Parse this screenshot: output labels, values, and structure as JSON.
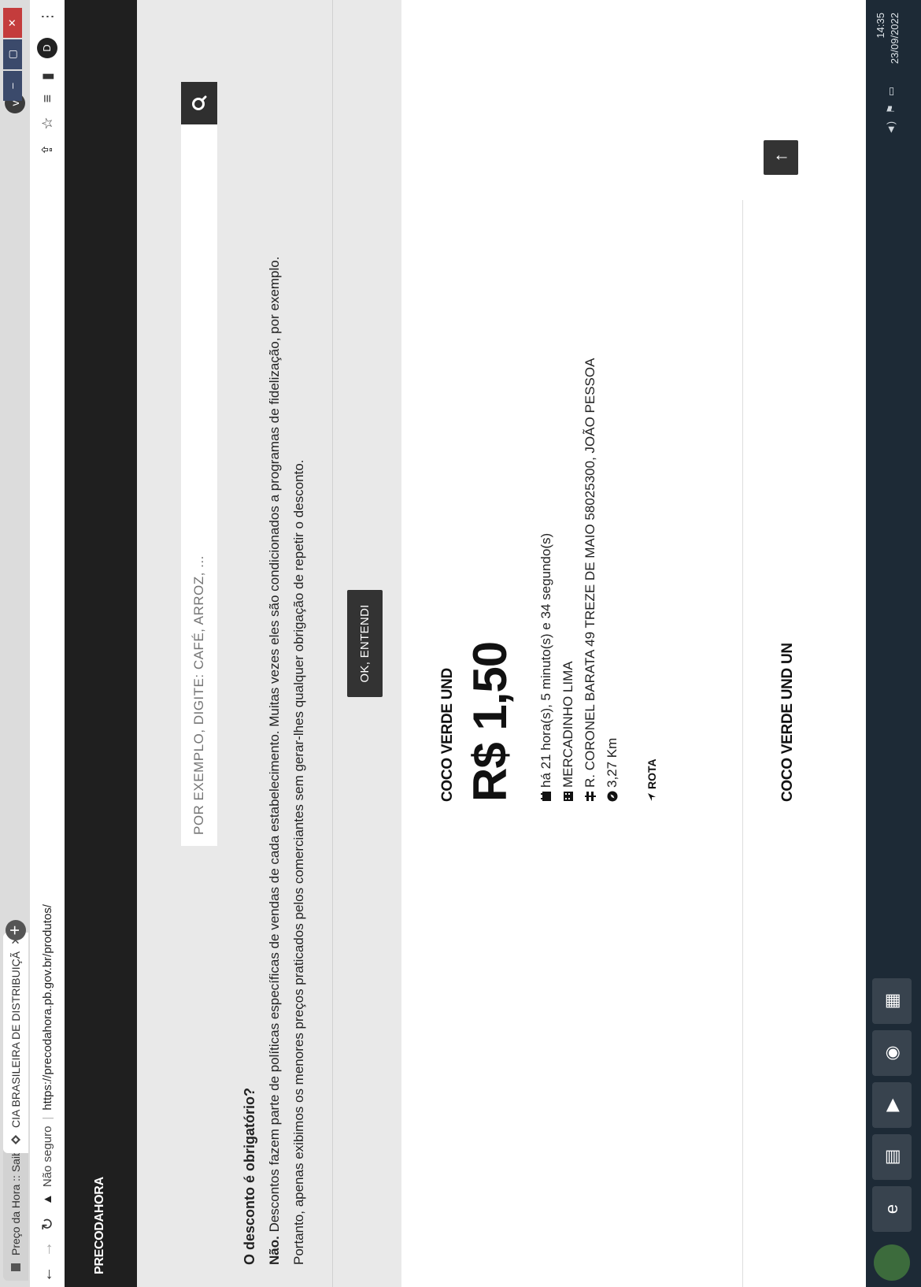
{
  "browser": {
    "tabs": [
      {
        "label": "Preço da Hora :: Saiba onde co",
        "active": false
      },
      {
        "label": "CIA BRASILEIRA DE DISTRIBUIÇÃ",
        "active": true
      }
    ],
    "close_glyph": "✕",
    "new_tab_glyph": "+",
    "security_label": "Não seguro",
    "url": "https://precodahora.pb.gov.br/produtos/",
    "avatar_initial": "D",
    "profile_chip_glyph": "v"
  },
  "header": {
    "brand": "PRECODAHORA"
  },
  "search": {
    "placeholder": "POR EXEMPLO, DIGITE: CAFÉ, ARROZ, ..."
  },
  "notice": {
    "question": "O desconto é obrigatório?",
    "answer_bold": "Não.",
    "answer_text": " Descontos fazem parte de políticas específicas de vendas de cada estabelecimento. Muitas vezes eles são condicionados a programas de fidelização, por exemplo.",
    "note": "Portanto, apenas exibimos os menores preços praticados pelos comerciantes sem gerar-lhes qualquer obrigação de repetir o desconto.",
    "ok_label": "OK, ENTENDI"
  },
  "results": [
    {
      "product": "COCO VERDE UND",
      "price": "R$ 1,50",
      "time_ago": "há 21 hora(s), 5 minuto(s) e 34 segundo(s)",
      "store": "MERCADINHO LIMA",
      "address": "R. CORONEL BARATA 49 TREZE DE MAIO 58025300, JOÃO PESSOA",
      "distance": "3,27 Km",
      "route_label": "ROTA"
    },
    {
      "product": "COCO VERDE UND UN"
    }
  ],
  "back_to_top_glyph": "↑",
  "taskbar": {
    "time": "14:35",
    "date": "23/09/2022"
  },
  "colors": {
    "appbar": "#1f1f1f",
    "panel": "#e9e9e9",
    "button_dark": "#333333",
    "taskbar": "#1d2a36"
  }
}
